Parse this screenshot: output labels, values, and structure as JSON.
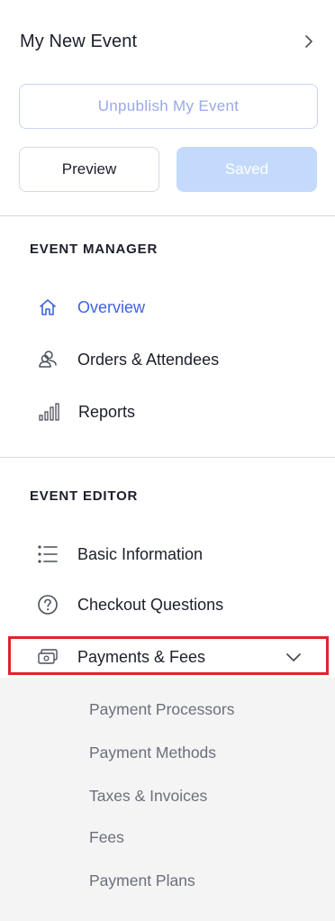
{
  "header": {
    "event_title": "My New Event",
    "unpublish_label": "Unpublish My Event",
    "preview_label": "Preview",
    "saved_label": "Saved"
  },
  "event_manager": {
    "title": "EVENT MANAGER",
    "items": [
      {
        "label": "Overview",
        "icon": "home-icon",
        "active": true
      },
      {
        "label": "Orders & Attendees",
        "icon": "attendees-icon",
        "active": false
      },
      {
        "label": "Reports",
        "icon": "bar-chart-icon",
        "active": false
      }
    ]
  },
  "event_editor": {
    "title": "EVENT EDITOR",
    "items": [
      {
        "label": "Basic Information",
        "icon": "list-icon"
      },
      {
        "label": "Checkout Questions",
        "icon": "question-circle-icon"
      },
      {
        "label": "Payments & Fees",
        "icon": "payments-icon",
        "expanded": true
      }
    ],
    "payments_submenu": [
      "Payment Processors",
      "Payment Methods",
      "Taxes & Invoices",
      "Fees",
      "Payment Plans"
    ]
  },
  "colors": {
    "accent": "#3d64e0",
    "highlight": "#e0242a",
    "saved_bg": "#c4dafc",
    "unpublish_text": "#9aa8ea",
    "submenu_bg": "#f4f4f5"
  }
}
